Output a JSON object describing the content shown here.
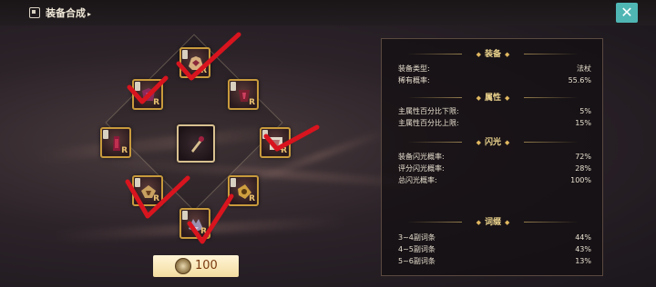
{
  "header": {
    "title": "装备合成",
    "title_suffix": "▸",
    "close_glyph": "✕"
  },
  "slots": [
    {
      "name": "slot-top",
      "grade": "R",
      "icon": "helmet-icon"
    },
    {
      "name": "slot-top-left",
      "grade": "R",
      "icon": "gear-icon"
    },
    {
      "name": "slot-top-right",
      "grade": "R",
      "icon": "gear-icon"
    },
    {
      "name": "slot-left",
      "grade": "R",
      "icon": "gear-icon"
    },
    {
      "name": "slot-center",
      "grade": "",
      "icon": "staff-icon"
    },
    {
      "name": "slot-right",
      "grade": "R",
      "icon": "gear-icon"
    },
    {
      "name": "slot-bottom-left",
      "grade": "R",
      "icon": "gear-icon"
    },
    {
      "name": "slot-bottom-right",
      "grade": "R",
      "icon": "gear-icon"
    },
    {
      "name": "slot-bottom",
      "grade": "R",
      "icon": "gear-icon"
    }
  ],
  "cost": {
    "value": "100",
    "icon": "coin-icon"
  },
  "panel": {
    "equipment": {
      "header": "装备",
      "rows": [
        {
          "label": "装备类型:",
          "value": "法杖"
        },
        {
          "label": "稀有概率:",
          "value": "55.6%"
        }
      ]
    },
    "attributes": {
      "header": "属性",
      "rows": [
        {
          "label": "主属性百分比下限:",
          "value": "5%"
        },
        {
          "label": "主属性百分比上限:",
          "value": "15%"
        }
      ]
    },
    "flash": {
      "header": "闪光",
      "rows": [
        {
          "label": "装备闪光概率:",
          "value": "72%"
        },
        {
          "label": "评分闪光概率:",
          "value": "28%"
        },
        {
          "label": "总闪光概率:",
          "value": "100%"
        }
      ]
    },
    "affix": {
      "header": "词缀",
      "rows": [
        {
          "label": "3~4副词条",
          "value": "44%"
        },
        {
          "label": "4~5副词条",
          "value": "43%"
        },
        {
          "label": "5~6副词条",
          "value": "13%"
        }
      ]
    }
  },
  "colors": {
    "accent": "#4fb6b4",
    "gold": "#c89a3c",
    "annotation_red": "#d8141e"
  }
}
